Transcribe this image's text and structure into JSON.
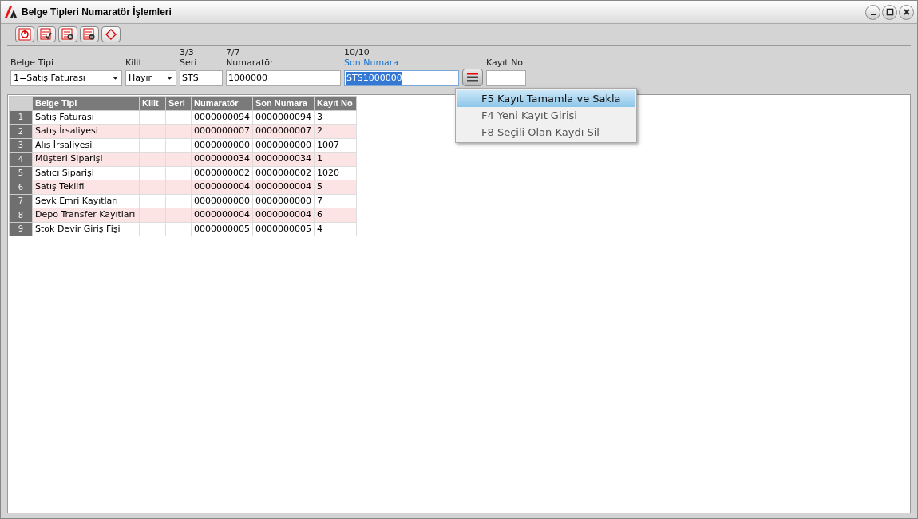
{
  "window": {
    "title": "Belge Tipleri Numaratör İşlemleri"
  },
  "toolbar": [
    {
      "kind": "power"
    },
    {
      "kind": "check"
    },
    {
      "kind": "add"
    },
    {
      "kind": "remove"
    },
    {
      "kind": "erase"
    }
  ],
  "form": [
    {
      "kind": "combo",
      "label": "Belge Tipi",
      "value": "1=Satış Faturası"
    },
    {
      "kind": "combo",
      "label": "Kilit",
      "value": "Hayır"
    },
    {
      "kind": "text",
      "counter": "3/3",
      "label": "Seri",
      "value": "STS",
      "focused": false
    },
    {
      "kind": "text",
      "counter": "7/7",
      "label": "Numaratör",
      "value": "1000000",
      "focused": false
    },
    {
      "kind": "text",
      "counter": "10/10",
      "label": "Son Numara",
      "value": "STS1000000",
      "focused": true
    },
    {
      "kind": "menu"
    },
    {
      "kind": "text",
      "label": "Kayıt No",
      "focused": false
    }
  ],
  "menu": [
    {
      "label": "F5 Kayıt Tamamla ve Sakla",
      "selected": true
    },
    {
      "label": "F4 Yeni Kayıt Girişi",
      "selected": false
    },
    {
      "label": "F8 Seçili Olan Kaydı Sil",
      "selected": false
    }
  ],
  "table": {
    "columns": [
      "",
      "Belge Tipi",
      "Kilit",
      "Seri",
      "Numaratör",
      "Son Numara",
      "Kayıt No"
    ],
    "rows": [
      [
        "1",
        "Satış Faturası",
        "",
        "",
        "0000000094",
        "0000000094",
        "3"
      ],
      [
        "2",
        "Satış İrsaliyesi",
        "",
        "",
        "0000000007",
        "0000000007",
        "2"
      ],
      [
        "3",
        "Alış İrsaliyesi",
        "",
        "",
        "0000000000",
        "0000000000",
        "1007"
      ],
      [
        "4",
        "Müşteri Siparişi",
        "",
        "",
        "0000000034",
        "0000000034",
        "1"
      ],
      [
        "5",
        "Satıcı Siparişi",
        "",
        "",
        "0000000002",
        "0000000002",
        "1020"
      ],
      [
        "6",
        "Satış Teklifi",
        "",
        "",
        "0000000004",
        "0000000004",
        "5"
      ],
      [
        "7",
        "Sevk Emri Kayıtları",
        "",
        "",
        "0000000000",
        "0000000000",
        "7"
      ],
      [
        "8",
        "Depo Transfer Kayıtları",
        "",
        "",
        "0000000004",
        "0000000004",
        "6"
      ],
      [
        "9",
        "Stok Devir Giriş Fişi",
        "",
        "",
        "0000000005",
        "0000000005",
        "4"
      ]
    ]
  }
}
